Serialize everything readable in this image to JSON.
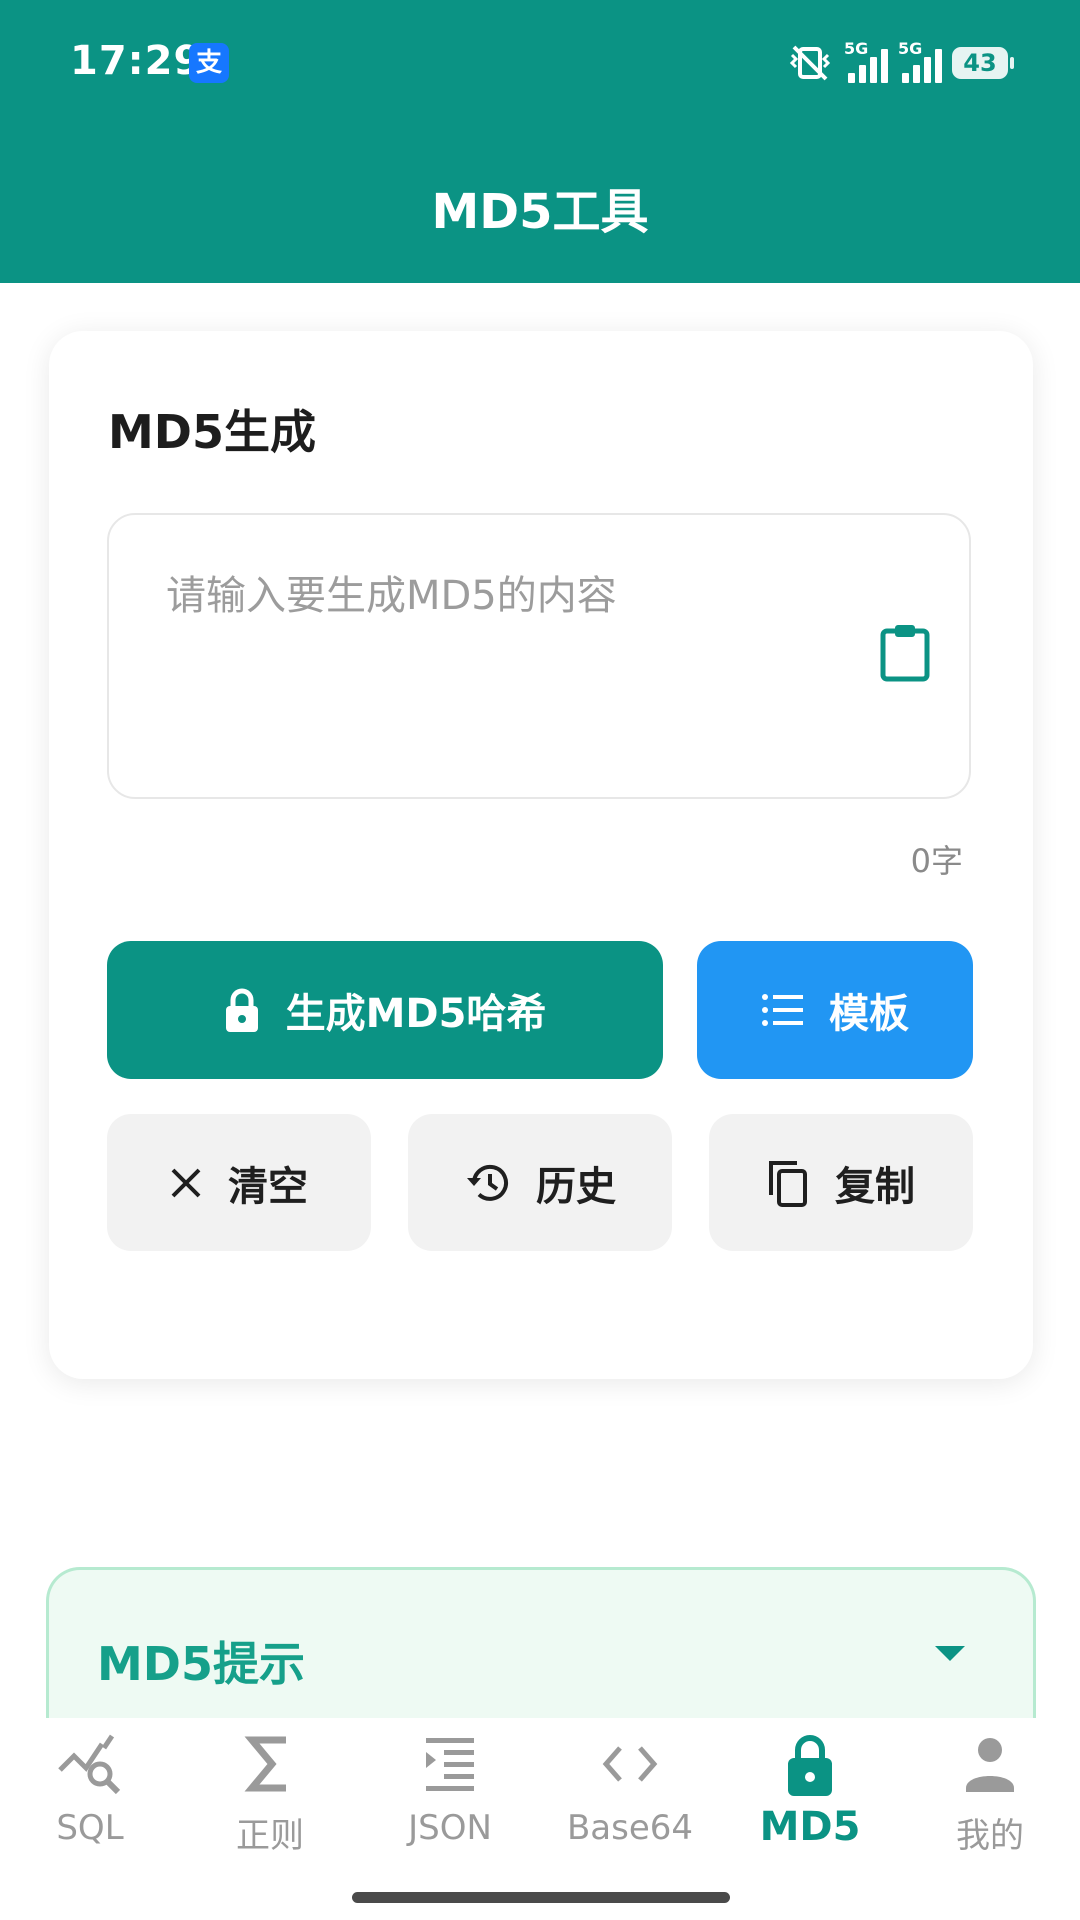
{
  "status_bar": {
    "time": "17:29",
    "app_badge": "支",
    "network_1": "5G",
    "network_2": "5G",
    "battery": "43"
  },
  "header": {
    "title": "MD5工具"
  },
  "card": {
    "title": "MD5生成",
    "input_placeholder": "请输入要生成MD5的内容",
    "input_value": "",
    "char_count": "0字",
    "buttons": {
      "generate": "生成MD5哈希",
      "template": "模板",
      "clear": "清空",
      "history": "历史",
      "copy": "复制"
    }
  },
  "tips": {
    "title": "MD5提示",
    "expanded": false
  },
  "bottom_nav": {
    "items": [
      {
        "label": "SQL",
        "icon": "query-stats-icon"
      },
      {
        "label": "正则",
        "icon": "sigma-icon"
      },
      {
        "label": "JSON",
        "icon": "format-indent-icon"
      },
      {
        "label": "Base64",
        "icon": "code-brackets-icon"
      },
      {
        "label": "MD5",
        "icon": "lock-icon",
        "active": true
      },
      {
        "label": "我的",
        "icon": "person-icon"
      }
    ]
  },
  "colors": {
    "primary": "#0b9384",
    "secondary": "#2196f3",
    "inactive": "#9a9a9a"
  }
}
